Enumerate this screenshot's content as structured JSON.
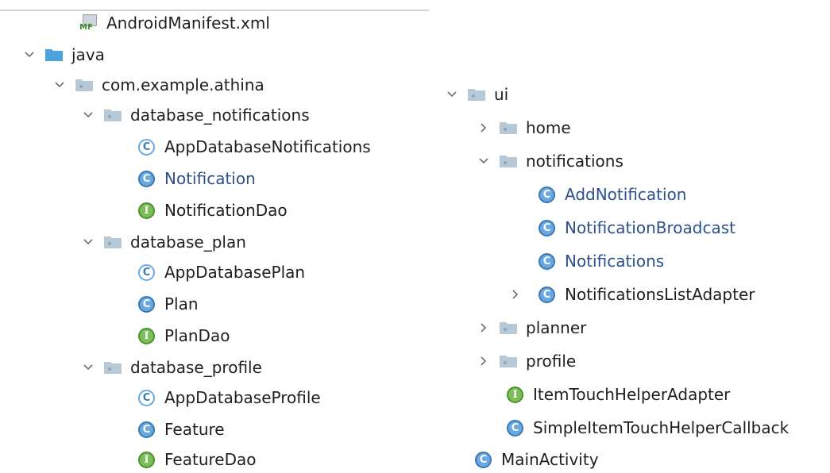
{
  "left_tree": {
    "manifest": "AndroidManifest.xml",
    "java": "java",
    "package": "com.example.athina",
    "db_notifications": {
      "folder": "database_notifications",
      "items": [
        "AppDatabaseNotifications",
        "Notification",
        "NotificationDao"
      ]
    },
    "db_plan": {
      "folder": "database_plan",
      "items": [
        "AppDatabasePlan",
        "Plan",
        "PlanDao"
      ]
    },
    "db_profile": {
      "folder": "database_profile",
      "items": [
        "AppDatabaseProfile",
        "Feature",
        "FeatureDao"
      ]
    }
  },
  "right_tree": {
    "ui": "ui",
    "home": "home",
    "notifications": {
      "folder": "notifications",
      "items": [
        "AddNotification",
        "NotificationBroadcast",
        "Notifications",
        "NotificationsListAdapter"
      ]
    },
    "planner": "planner",
    "profile": "profile",
    "items": [
      "ItemTouchHelperAdapter",
      "SimpleItemTouchHelperCallback",
      "MainActivity"
    ]
  },
  "icon_badges": {
    "class": "C",
    "interface": "I",
    "manifest": "MF"
  },
  "colors": {
    "folder": "#8fb6d6",
    "folder_open_java": "#4aa3df",
    "class_badge": "#6aa9e0",
    "interface_badge": "#7cbf5a",
    "modified_text": "#2d4f8c"
  }
}
